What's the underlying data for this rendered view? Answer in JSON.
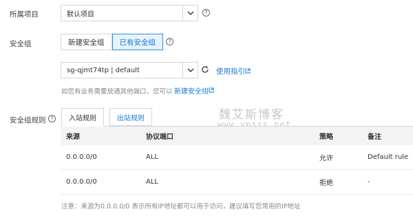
{
  "project": {
    "label": "所属项目",
    "value": "默认项目"
  },
  "security_group": {
    "label": "安全组",
    "options": [
      "新建安全组",
      "已有安全组"
    ],
    "selected": "已有安全组"
  },
  "sg_select": {
    "value": "sg-qjmt74tp | default",
    "guide_link": "使用指引"
  },
  "hint": {
    "text": "如您有业务需要放通其他端口，您可以",
    "link": "新建安全组"
  },
  "rules": {
    "label": "安全组规则",
    "tabs": [
      "入站规则",
      "出站规则"
    ],
    "active_tab": "入站规则",
    "columns": [
      "来源",
      "协议端口",
      "策略",
      "备注"
    ],
    "rows": [
      [
        "0.0.0.0/0",
        "ALL",
        "允许",
        "Default rule"
      ],
      [
        "0.0.0.0/0",
        "ALL",
        "拒绝",
        "-"
      ]
    ],
    "note": "注意：来源为0.0.0.0/0 表示所有IP地址都可以用于访问，建议填写您常用的IP地址"
  },
  "watermark": {
    "line1": "魏艾斯博客",
    "line2": "www.vpsss.net"
  },
  "colors": {
    "accent": "#1a7ad0",
    "active_bg": "#e6f2fd",
    "header_bg": "#f3f3f3"
  }
}
